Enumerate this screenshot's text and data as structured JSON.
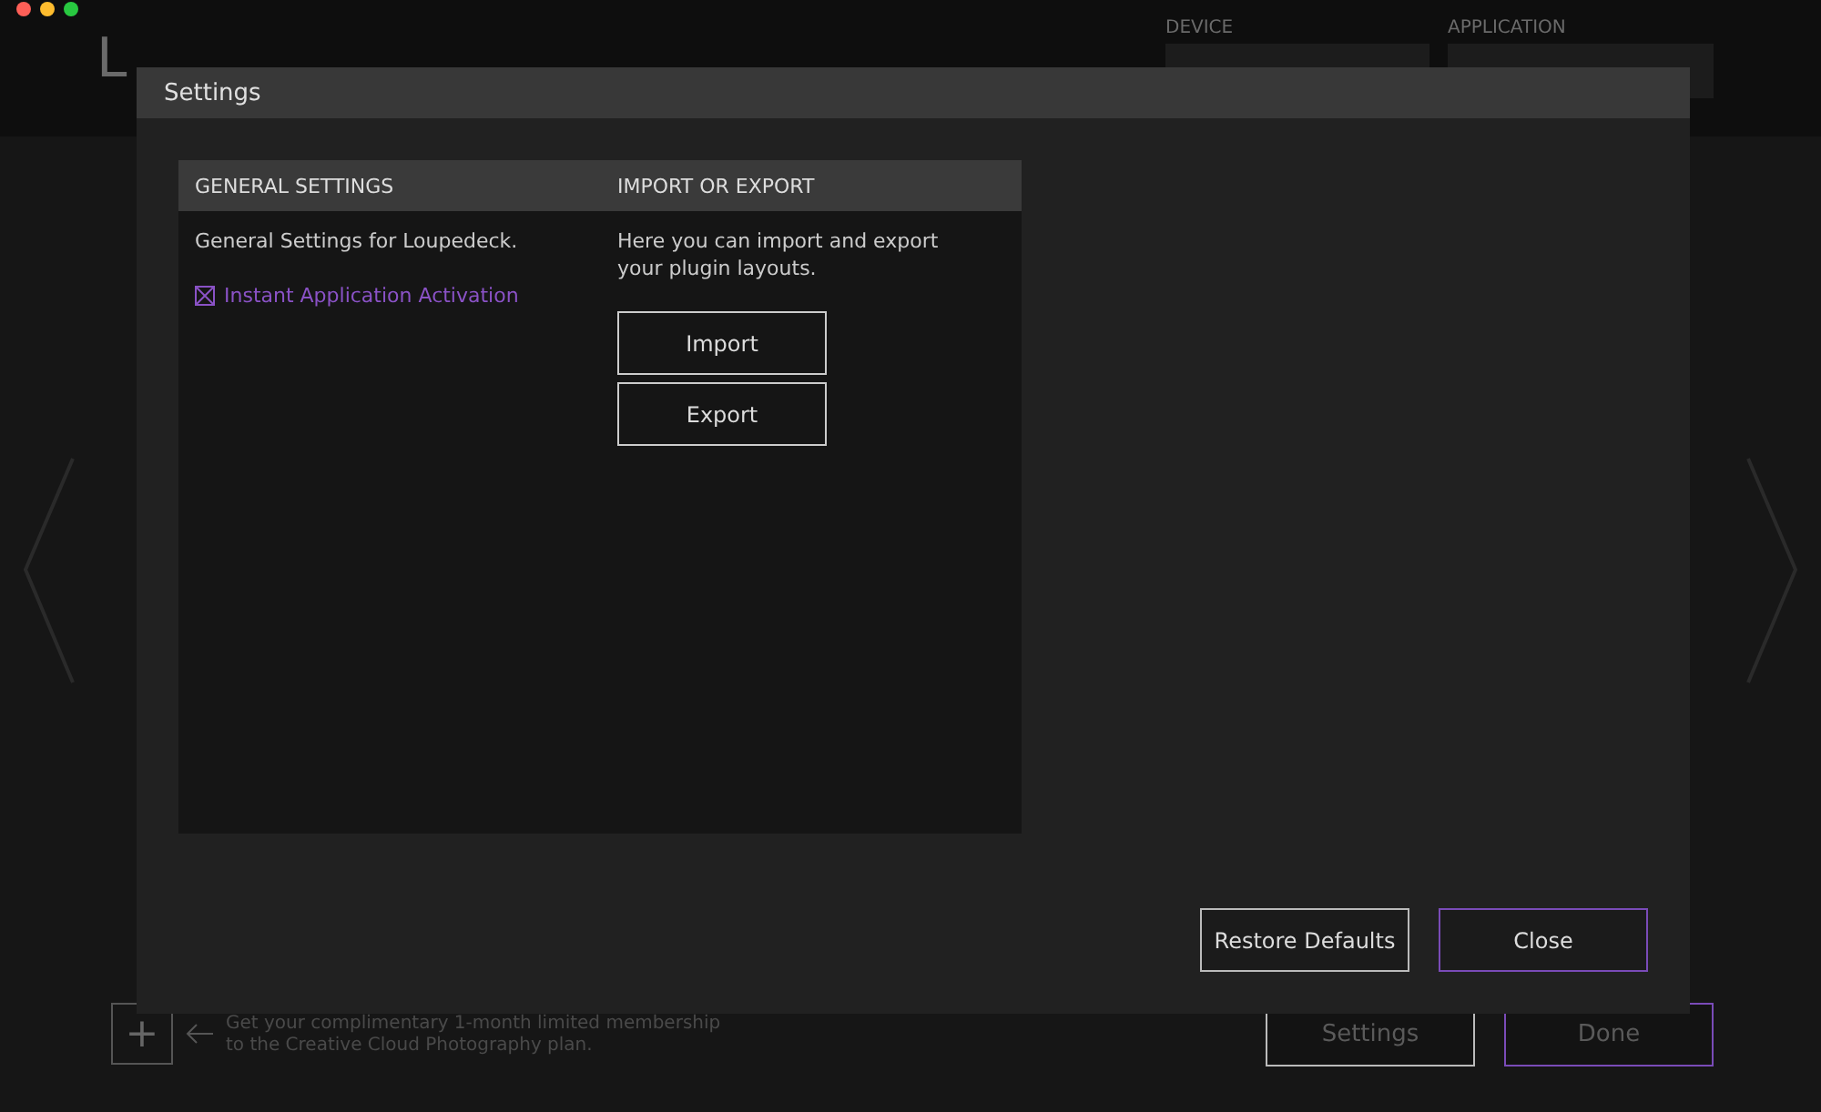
{
  "background_app": {
    "logo": "L",
    "device_label": "DEVICE",
    "application_label": "APPLICATION",
    "promo": "Get your complimentary 1-month limited membership\nto the Creative Cloud Photography plan.",
    "buttons": [
      {
        "label": "Settings",
        "kind": "plain"
      },
      {
        "label": "Done",
        "kind": "primary"
      }
    ],
    "add_button": "+"
  },
  "dialog": {
    "title": "Settings",
    "sections": [
      {
        "heading": "GENERAL SETTINGS",
        "description": "General Settings for Loupedeck.",
        "options": [
          {
            "label": "Instant Application Activation",
            "checked": true
          }
        ]
      },
      {
        "heading": "IMPORT OR EXPORT",
        "description": "Here you can import and export your plugin layouts.",
        "buttons": [
          "Import",
          "Export"
        ]
      }
    ],
    "buttons": [
      {
        "label": "Restore Defaults",
        "kind": "plain"
      },
      {
        "label": "Close",
        "kind": "primary"
      }
    ]
  }
}
